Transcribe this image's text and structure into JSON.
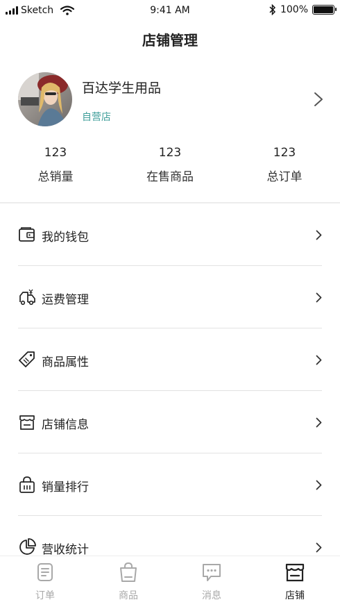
{
  "status_bar": {
    "carrier": "Sketch",
    "time": "9:41 AM",
    "battery": "100%"
  },
  "nav": {
    "title": "店铺管理"
  },
  "store": {
    "name": "百达学生用品",
    "tag": "自营店"
  },
  "stats": [
    {
      "value": "123",
      "label": "总销量"
    },
    {
      "value": "123",
      "label": "在售商品"
    },
    {
      "value": "123",
      "label": "总订单"
    }
  ],
  "menu": [
    {
      "label": "我的钱包",
      "icon": "wallet-icon"
    },
    {
      "label": "运费管理",
      "icon": "delivery-truck-icon"
    },
    {
      "label": "商品属性",
      "icon": "price-tag-icon"
    },
    {
      "label": "店铺信息",
      "icon": "storefront-icon"
    },
    {
      "label": "销量排行",
      "icon": "shopping-basket-icon"
    },
    {
      "label": "营收统计",
      "icon": "pie-chart-icon"
    }
  ],
  "tabs": [
    {
      "label": "订单",
      "icon": "order-document-icon",
      "active": false
    },
    {
      "label": "商品",
      "icon": "shopping-bag-icon",
      "active": false
    },
    {
      "label": "消息",
      "icon": "chat-bubble-icon",
      "active": false
    },
    {
      "label": "店铺",
      "icon": "storefront-icon",
      "active": true
    }
  ],
  "colors": {
    "accent_teal": "#3f9e9a",
    "inactive_tab": "#a8a8a8",
    "text": "#222222"
  }
}
